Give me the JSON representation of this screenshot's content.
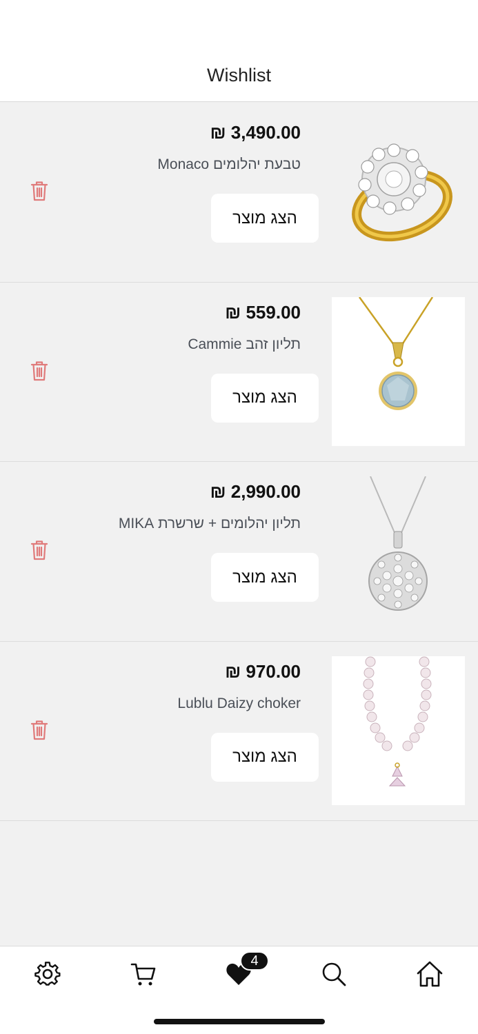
{
  "header": {
    "title": "Wishlist"
  },
  "wishlist": {
    "view_label": "הצג מוצר",
    "items": [
      {
        "price": "₪ 3,490.00",
        "name": "טבעת יהלומים Monaco",
        "image": "gold-diamond-ring"
      },
      {
        "price": "₪ 559.00",
        "name": "תליון זהב Cammie",
        "image": "gold-aquamarine-pendant"
      },
      {
        "price": "₪ 2,990.00",
        "name": "תליון יהלומים + שרשרת MIKA",
        "image": "diamond-cluster-pendant"
      },
      {
        "price": "₪ 970.00",
        "name": "Lublu Daizy choker",
        "image": "pearl-choker-butterfly"
      }
    ]
  },
  "tabbar": {
    "items": [
      "gear-icon",
      "cart-icon",
      "heart-icon",
      "search-icon",
      "home-icon"
    ],
    "wishlist_count": "4"
  },
  "colors": {
    "accent_delete": "#e07a7a",
    "badge": "#111111"
  }
}
